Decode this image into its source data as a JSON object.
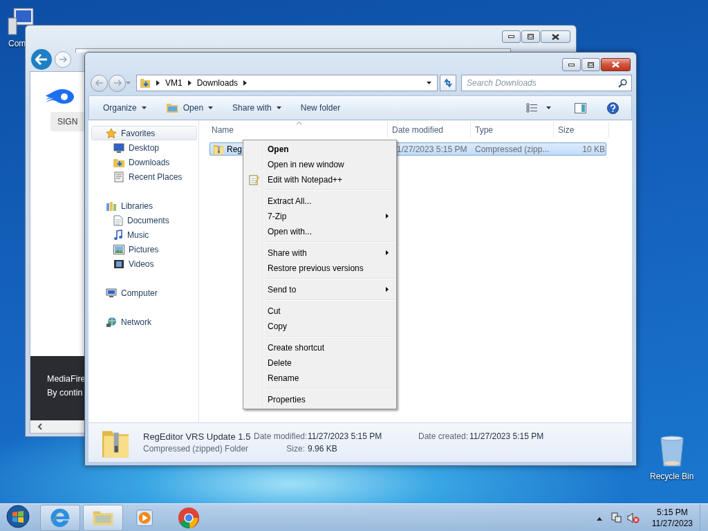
{
  "desktop_icons": [
    {
      "label": "Com"
    },
    {
      "label": "Recycle Bin"
    }
  ],
  "browser_window": {
    "button_label": "SIGN",
    "banner_lines": [
      "MediaFire",
      "By contin"
    ]
  },
  "explorer_window": {
    "breadcrumb": [
      "VM1",
      "Downloads"
    ],
    "search": {
      "placeholder": "Search Downloads"
    },
    "toolbar": [
      {
        "label": "Organize",
        "dropdown": true,
        "icon": false
      },
      {
        "label": "Open",
        "dropdown": true,
        "icon": true
      },
      {
        "label": "Share with",
        "dropdown": true,
        "icon": false
      },
      {
        "label": "New folder",
        "dropdown": false,
        "icon": false
      }
    ],
    "navigation": [
      {
        "label": "Favorites",
        "selected": true,
        "children": [
          {
            "label": "Desktop",
            "selected": false
          },
          {
            "label": "Downloads",
            "selected": false
          },
          {
            "label": "Recent Places",
            "selected": false
          }
        ]
      },
      {
        "label": "Libraries",
        "selected": false,
        "children": [
          {
            "label": "Documents",
            "selected": false
          },
          {
            "label": "Music",
            "selected": false
          },
          {
            "label": "Pictures",
            "selected": false
          },
          {
            "label": "Videos",
            "selected": false
          }
        ]
      },
      {
        "label": "Computer",
        "selected": false
      },
      {
        "label": "Network",
        "selected": false
      }
    ],
    "columns": [
      {
        "label": "Name",
        "sorted": true
      },
      {
        "label": "Date modified",
        "sorted": false
      },
      {
        "label": "Type",
        "sorted": false
      },
      {
        "label": "Size",
        "sorted": false
      }
    ],
    "rows": [
      {
        "name": "Reg",
        "date_modified": "1/27/2023 5:15 PM",
        "type": "Compressed (zipp...",
        "size": "10 KB",
        "selected": true
      }
    ],
    "details": {
      "name": "RegEditor VRS Update 1.5",
      "type": "Compressed (zipped) Folder",
      "fields": [
        {
          "label": "Date modified:",
          "value": "11/27/2023 5:15 PM"
        },
        {
          "label": "Size:",
          "value": "9.96 KB"
        },
        {
          "label": "Date created:",
          "value": "11/27/2023 5:15 PM"
        }
      ]
    }
  },
  "context_menu": {
    "groups": [
      [
        {
          "label": "Open",
          "default": true,
          "submenu": false,
          "icon": false
        },
        {
          "label": "Open in new window",
          "default": false,
          "submenu": false,
          "icon": false
        },
        {
          "label": "Edit with Notepad++",
          "default": false,
          "submenu": false,
          "icon": true
        }
      ],
      [
        {
          "label": "Extract All...",
          "default": false,
          "submenu": false,
          "icon": false
        },
        {
          "label": "7-Zip",
          "default": false,
          "submenu": true,
          "icon": false
        },
        {
          "label": "Open with...",
          "default": false,
          "submenu": false,
          "icon": false
        }
      ],
      [
        {
          "label": "Share with",
          "default": false,
          "submenu": true,
          "icon": false
        },
        {
          "label": "Restore previous versions",
          "default": false,
          "submenu": false,
          "icon": false
        }
      ],
      [
        {
          "label": "Send to",
          "default": false,
          "submenu": true,
          "icon": false
        }
      ],
      [
        {
          "label": "Cut",
          "default": false,
          "submenu": false,
          "icon": false
        },
        {
          "label": "Copy",
          "default": false,
          "submenu": false,
          "icon": false
        }
      ],
      [
        {
          "label": "Create shortcut",
          "default": false,
          "submenu": false,
          "icon": false
        },
        {
          "label": "Delete",
          "default": false,
          "submenu": false,
          "icon": false
        },
        {
          "label": "Rename",
          "default": false,
          "submenu": false,
          "icon": false
        }
      ],
      [
        {
          "label": "Properties",
          "default": false,
          "submenu": false,
          "icon": false
        }
      ]
    ]
  },
  "taskbar": {
    "apps": [
      {
        "running": true,
        "active": false
      },
      {
        "running": true,
        "active": true
      },
      {
        "running": false,
        "active": false
      },
      {
        "running": false,
        "active": false
      }
    ],
    "clock": {
      "time": "5:15 PM",
      "date": "11/27/2023"
    }
  }
}
